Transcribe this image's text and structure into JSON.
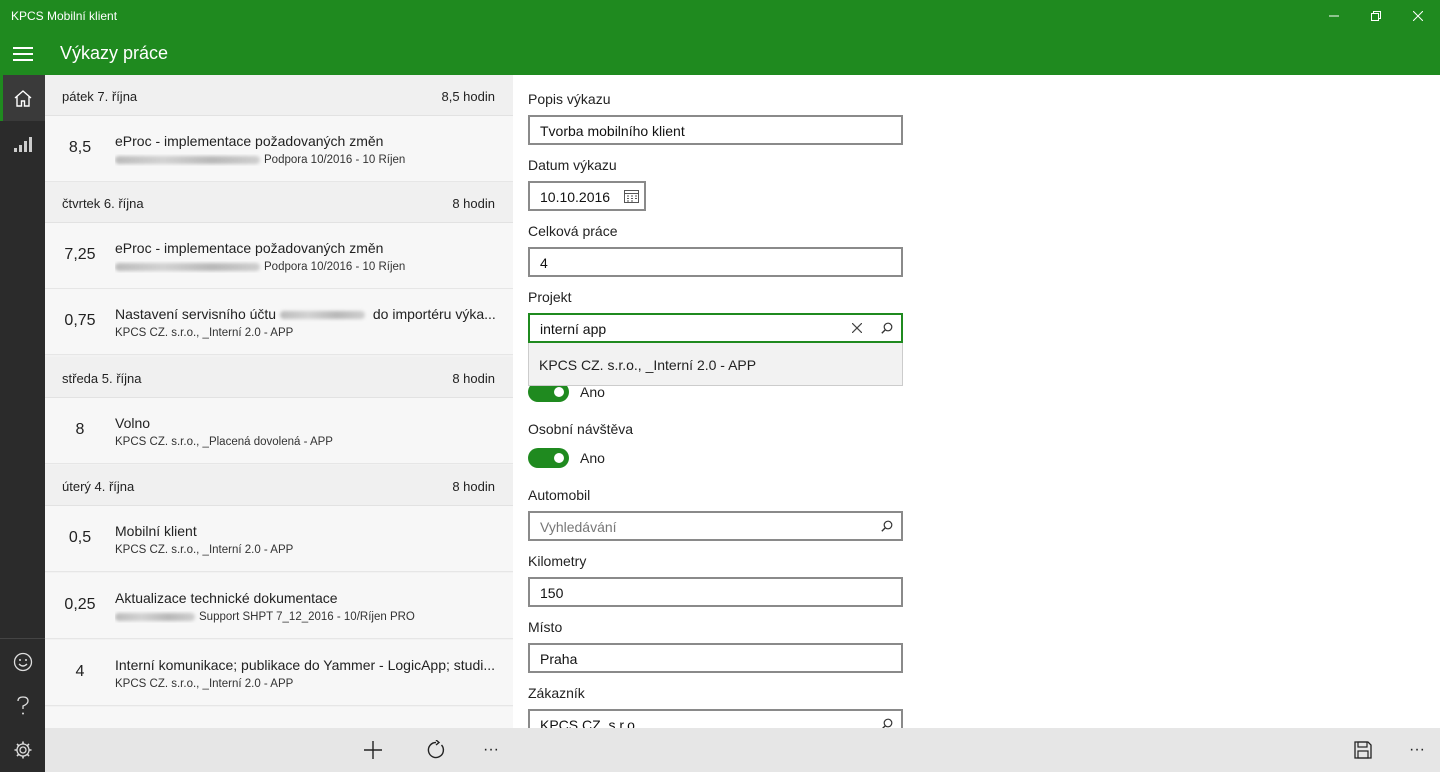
{
  "window": {
    "title": "KPCS Mobilní klient"
  },
  "header": {
    "title": "Výkazy práce"
  },
  "nav": {
    "items": [
      {
        "name": "home",
        "icon": "home-icon"
      },
      {
        "name": "statistics",
        "icon": "signal-bars-icon"
      },
      {
        "name": "feedback",
        "icon": "smiley-icon"
      },
      {
        "name": "help",
        "icon": "question-icon"
      },
      {
        "name": "settings",
        "icon": "gear-icon"
      }
    ]
  },
  "list": {
    "groups": [
      {
        "date": "pátek 7. října",
        "total": "8,5 hodin",
        "entries": [
          {
            "hours": "8,5",
            "title": "eProc - implementace požadovaných změn",
            "subtitle": "Podpora 10/2016 - 10 Říjen"
          }
        ]
      },
      {
        "date": "čtvrtek 6. října",
        "total": "8 hodin",
        "entries": [
          {
            "hours": "7,25",
            "title": "eProc - implementace požadovaných změn",
            "subtitle": "Podpora 10/2016 - 10 Říjen"
          },
          {
            "hours": "0,75",
            "title_before": "Nastavení servisního účtu",
            "title_after": "do importéru výka...",
            "subtitle": "KPCS CZ. s.r.o., _Interní 2.0 - APP"
          }
        ]
      },
      {
        "date": "středa 5. října",
        "total": "8 hodin",
        "entries": [
          {
            "hours": "8",
            "title": "Volno",
            "subtitle": "KPCS CZ. s.r.o., _Placená dovolená - APP"
          }
        ]
      },
      {
        "date": "úterý 4. října",
        "total": "8 hodin",
        "entries": [
          {
            "hours": "0,5",
            "title": "Mobilní klient",
            "subtitle": "KPCS CZ. s.r.o., _Interní 2.0 - APP"
          },
          {
            "hours": "0,25",
            "title": "Aktualizace technické dokumentace",
            "subtitle": "Support SHPT 7_12_2016 - 10/Říjen PRO"
          },
          {
            "hours": "4",
            "title": "Interní komunikace; publikace do Yammer - LogicApp; studi...",
            "subtitle": "KPCS CZ. s.r.o., _Interní 2.0 - APP"
          }
        ]
      }
    ]
  },
  "form": {
    "description": {
      "label": "Popis výkazu",
      "value": "Tvorba mobilního klient"
    },
    "date": {
      "label": "Datum výkazu",
      "value": "10.10.2016"
    },
    "total_work": {
      "label": "Celková práce",
      "value": "4"
    },
    "project": {
      "label": "Projekt",
      "value": "interní app",
      "suggestion": "KPCS CZ. s.r.o., _Interní 2.0 - APP"
    },
    "hidden_toggle": {
      "state_text": "Ano"
    },
    "personal_visit": {
      "label": "Osobní návštěva",
      "state_text": "Ano"
    },
    "car": {
      "label": "Automobil",
      "placeholder": "Vyhledávání"
    },
    "kilometers": {
      "label": "Kilometry",
      "value": "150"
    },
    "place": {
      "label": "Místo",
      "value": "Praha"
    },
    "customer": {
      "label": "Zákazník",
      "value": "KPCS CZ. s.r.o."
    }
  },
  "commandbar": {
    "left": [
      {
        "name": "add",
        "icon": "plus-icon"
      },
      {
        "name": "refresh",
        "icon": "refresh-icon"
      },
      {
        "name": "more",
        "label": "···"
      }
    ],
    "right": [
      {
        "name": "save",
        "icon": "save-icon"
      },
      {
        "name": "more",
        "label": "···"
      }
    ]
  },
  "colors": {
    "accent": "#1f8a1f",
    "nav_bg": "#2b2b2b",
    "list_bg": "#f2f2f2",
    "cmdbar_bg": "#e6e6e6"
  }
}
